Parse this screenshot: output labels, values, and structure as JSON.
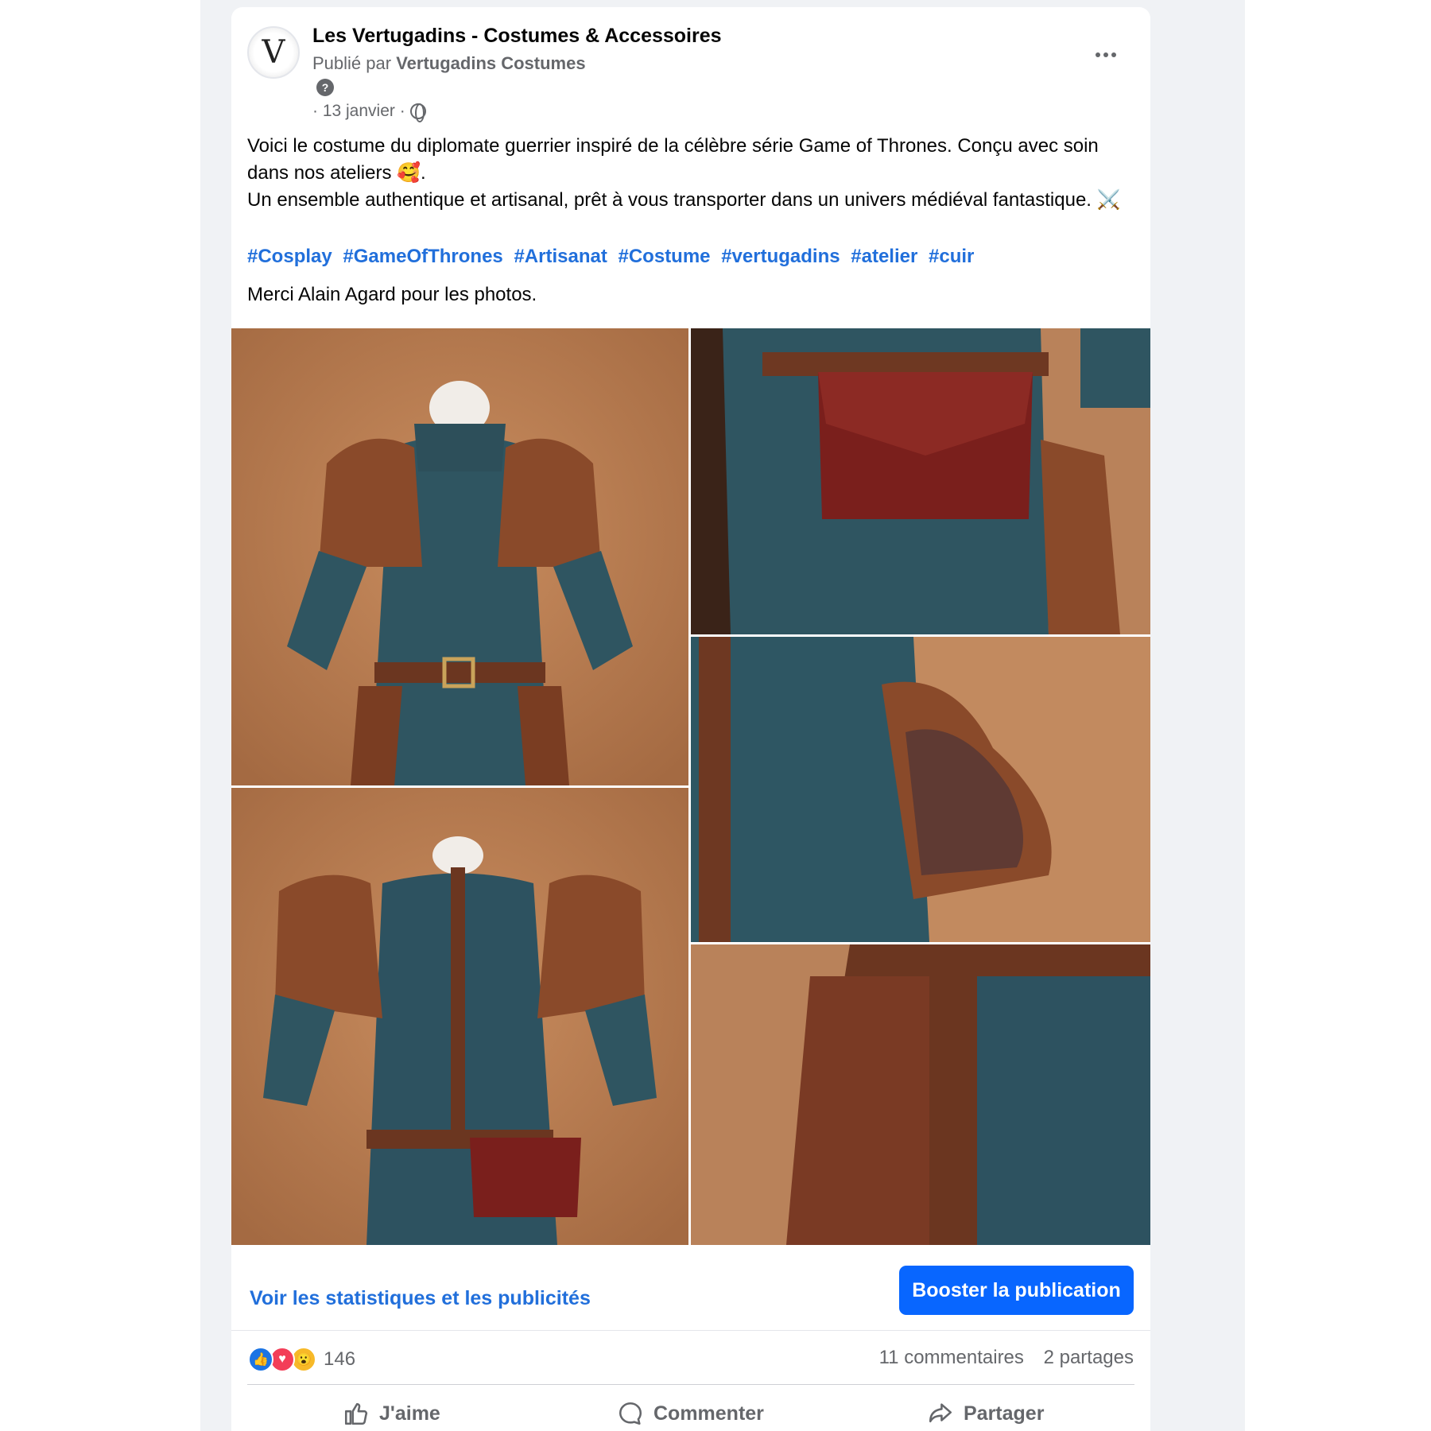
{
  "post": {
    "page_name": "Les Vertugadins - Costumes & Accessoires",
    "published_prefix": "Publié par",
    "published_by": "Vertugadins Costumes",
    "help_icon": "?",
    "date": "· 13 janvier ·",
    "avatar_letter": "V",
    "text_lines": [
      "Voici le costume du diplomate guerrier inspiré de la célèbre série Game of Thrones. Conçu avec soin dans nos ateliers 🥰.",
      "Un ensemble authentique et artisanal, prêt à vous transporter dans un univers médiéval fantastique. ⚔️"
    ],
    "hashtags": [
      "#Cosplay",
      "#GameOfThrones",
      "#Artisanat",
      "#Costume",
      "#vertugadins",
      "#atelier",
      "#cuir"
    ],
    "credit": "Merci Alain Agard pour les photos."
  },
  "promo": {
    "stats_link": "Voir les statistiques et les publicités",
    "boost_button": "Booster la publication"
  },
  "engagement": {
    "reactions": [
      "like",
      "love",
      "wow"
    ],
    "reaction_count": "146",
    "comments": "11 commentaires",
    "shares": "2 partages"
  },
  "actions": {
    "like": "J'aime",
    "comment": "Commenter",
    "share": "Partager"
  },
  "colors": {
    "link_blue": "#216fdb",
    "boost_blue": "#0866ff",
    "muted_text": "#65676b",
    "feed_bg": "#f0f2f5"
  }
}
